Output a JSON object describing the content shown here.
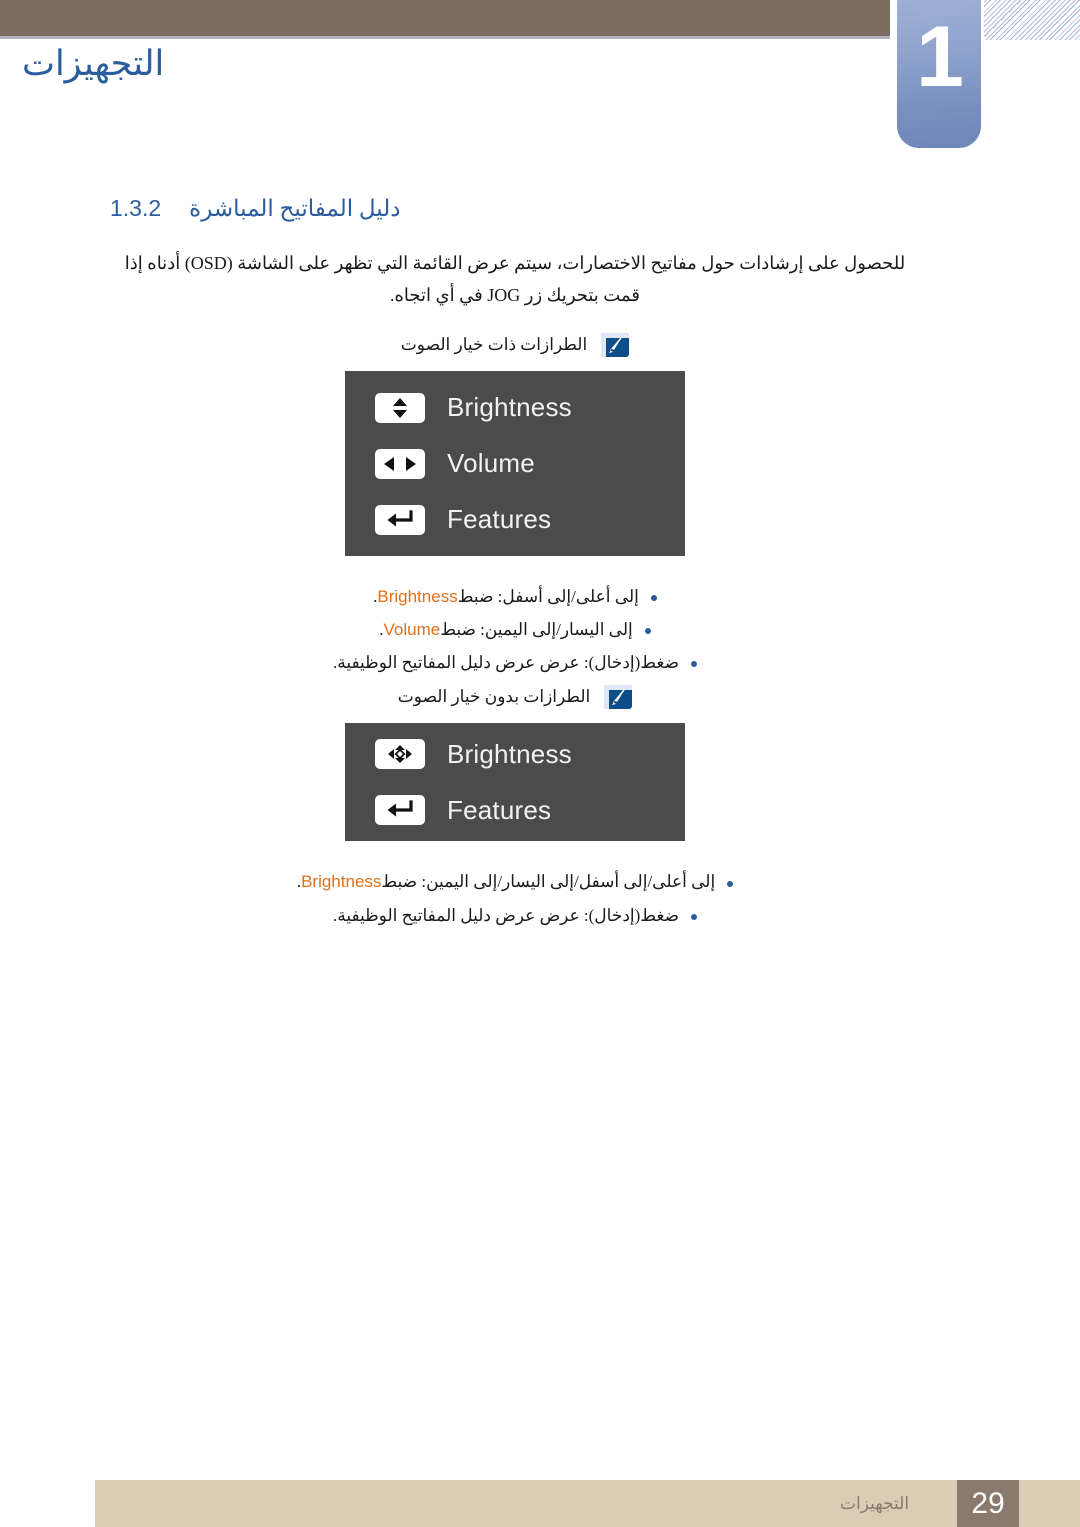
{
  "header": {
    "chapter_number": "1",
    "chapter_title": "التجهيزات"
  },
  "section": {
    "number": "1.3.2",
    "title": "دليل المفاتيح المباشرة"
  },
  "intro": "للحصول على إرشادات حول مفاتيح الاختصارات، سيتم عرض القائمة التي تظهر على الشاشة (OSD) أدناه إذا قمت بتحريك زر JOG في أي اتجاه.",
  "note_with_sound": {
    "icon": "note-hand-icon",
    "text": "الطرازات ذات خيار الصوت"
  },
  "note_without_sound": {
    "icon": "note-hand-icon",
    "text": "الطرازات بدون خيار الصوت"
  },
  "osd_panel_with_sound": {
    "rows": [
      {
        "icon": "up-down-arrows-icon",
        "label": "Brightness"
      },
      {
        "icon": "left-right-arrows-icon",
        "label": "Volume"
      },
      {
        "icon": "enter-return-icon",
        "label": "Features"
      }
    ]
  },
  "osd_panel_without_sound": {
    "rows": [
      {
        "icon": "four-way-arrows-icon",
        "label": "Brightness"
      },
      {
        "icon": "enter-return-icon",
        "label": "Features"
      }
    ]
  },
  "bullets_with_sound": [
    {
      "pre": "إلى أعلى/إلى أسفل: ضبط",
      "en": "Brightness",
      "post": "."
    },
    {
      "pre": "إلى اليسار/إلى اليمين: ضبط",
      "en": "Volume",
      "post": "."
    },
    {
      "pre": "ضغط(إدخال): عرض عرض دليل المفاتيح الوظيفية.",
      "en": "",
      "post": ""
    }
  ],
  "bullets_without_sound": [
    {
      "pre": "إلى أعلى/إلى أسفل/إلى اليسار/إلى اليمين: ضبط",
      "en": "Brightness",
      "post": "."
    },
    {
      "pre": "ضغط(إدخال): عرض عرض دليل المفاتيح الوظيفية.",
      "en": "",
      "post": ""
    }
  ],
  "footer": {
    "label": "التجهيزات",
    "page_number": "29"
  },
  "colors": {
    "header_bar": "#7b6d60",
    "chapter_badge": "#8fa3ce",
    "heading_blue": "#2b5c9e",
    "accent_orange": "#e0701a",
    "osd_background": "#4b4b4b",
    "footer_bar": "#d9cdb6",
    "footer_page_box": "#8a7a6d"
  }
}
